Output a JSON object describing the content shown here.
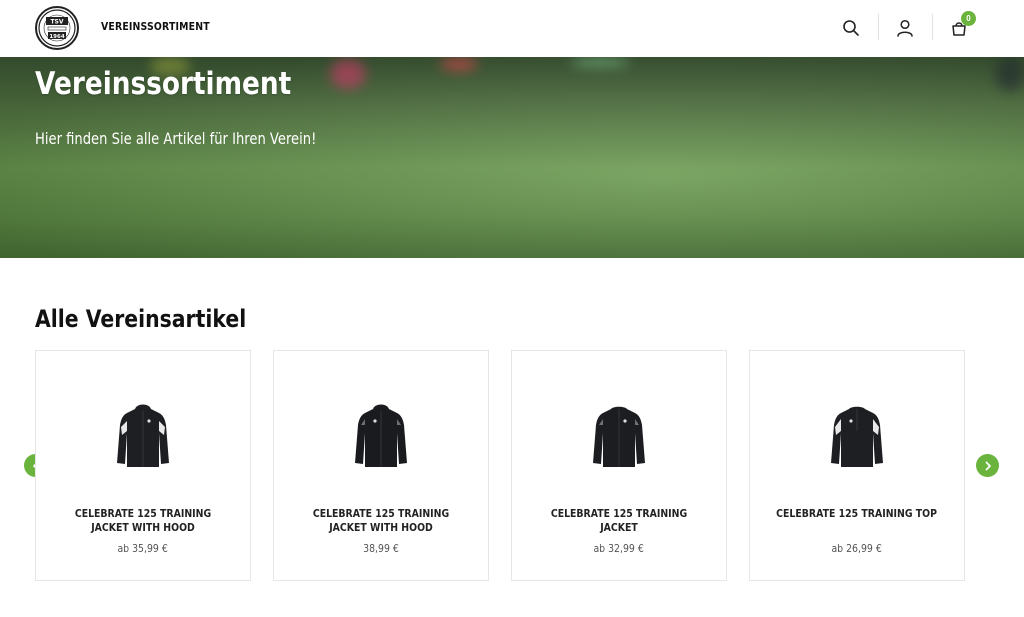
{
  "header": {
    "nav_label": "VEREINSSORTIMENT",
    "logo_text": "TSV 1964",
    "cart_count": "0",
    "icons": [
      "search-icon",
      "user-icon",
      "cart-icon"
    ]
  },
  "hero": {
    "title": "Vereinssortiment",
    "subtitle": "Hier finden Sie alle Artikel für Ihren Verein!"
  },
  "section": {
    "title": "Alle Vereinsartikel"
  },
  "products": [
    {
      "name": "CELEBRATE 125 TRAINING JACKET WITH HOOD",
      "price": "ab 35,99 €",
      "variant": "hood-white"
    },
    {
      "name": "CELEBRATE 125 TRAINING JACKET WITH HOOD",
      "price": "38,99 €",
      "variant": "hood"
    },
    {
      "name": "CELEBRATE 125 TRAINING JACKET",
      "price": "ab 32,99 €",
      "variant": "jacket"
    },
    {
      "name": "CELEBRATE 125 TRAINING TOP",
      "price": "ab 26,99 €",
      "variant": "top-white"
    }
  ],
  "colors": {
    "accent": "#6ab33c",
    "text": "#111111",
    "card_border": "#e6e6e6"
  }
}
